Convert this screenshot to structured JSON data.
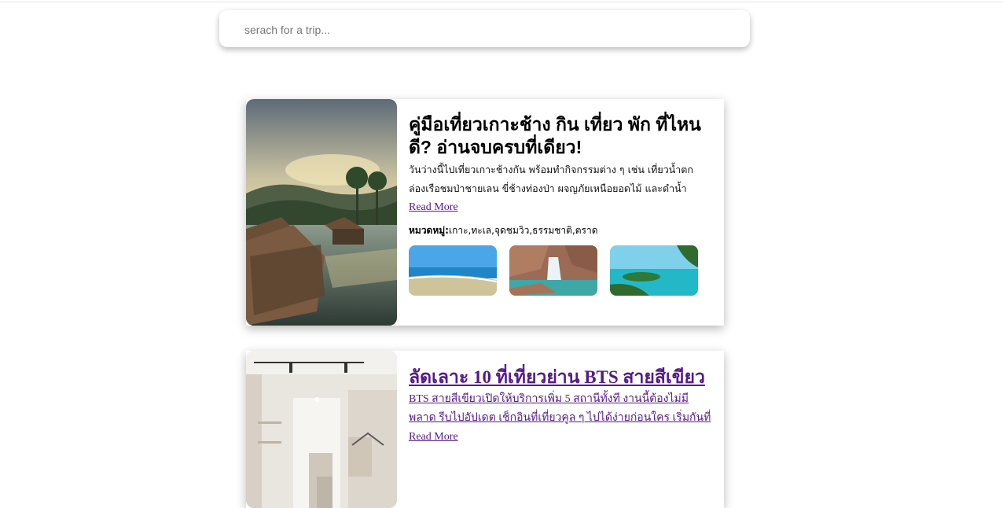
{
  "search": {
    "placeholder": "serach for a trip..."
  },
  "articles": [
    {
      "title": "คู่มือเที่ยวเกาะช้าง กิน เที่ยว พัก ที่ไหนดี? อ่านจบครบที่เดียว!",
      "description": "วันว่างนี้ไปเที่ยวเกาะช้างกัน พร้อมทำกิจกรรมต่าง ๆ เช่น เที่ยวน้ำตก ล่องเรือชมป่าชายเลน ขี่ช้างท่องป่า ผจญภัยเหนือยอดไม้ และดำน้ำ",
      "read_more": "Read More",
      "categories_label": "หมวดหมู่:",
      "categories": "เกาะ,ทะเล,จุดชมวิว,ธรรมชาติ,ตราด",
      "gallery": [
        "beach-photo",
        "waterfall-photo",
        "island-photo"
      ]
    },
    {
      "title": "ลัดเลาะ 10 ที่เที่ยวย่าน BTS สายสีเขียว",
      "description": "BTS สายสีเขียวเปิดให้บริการเพิ่ม 5 สถานีทั้งที งานนี้ต้องไม่มีพลาด รีบไปอัปเดต เช็กอินที่เที่ยวคูล ๆ ไปได้ง่ายก่อนใคร เริ่มกันที่ 'สถานี",
      "read_more": "Read More"
    }
  ],
  "colors": {
    "link": "#551a8b",
    "background": "#ffffff"
  }
}
